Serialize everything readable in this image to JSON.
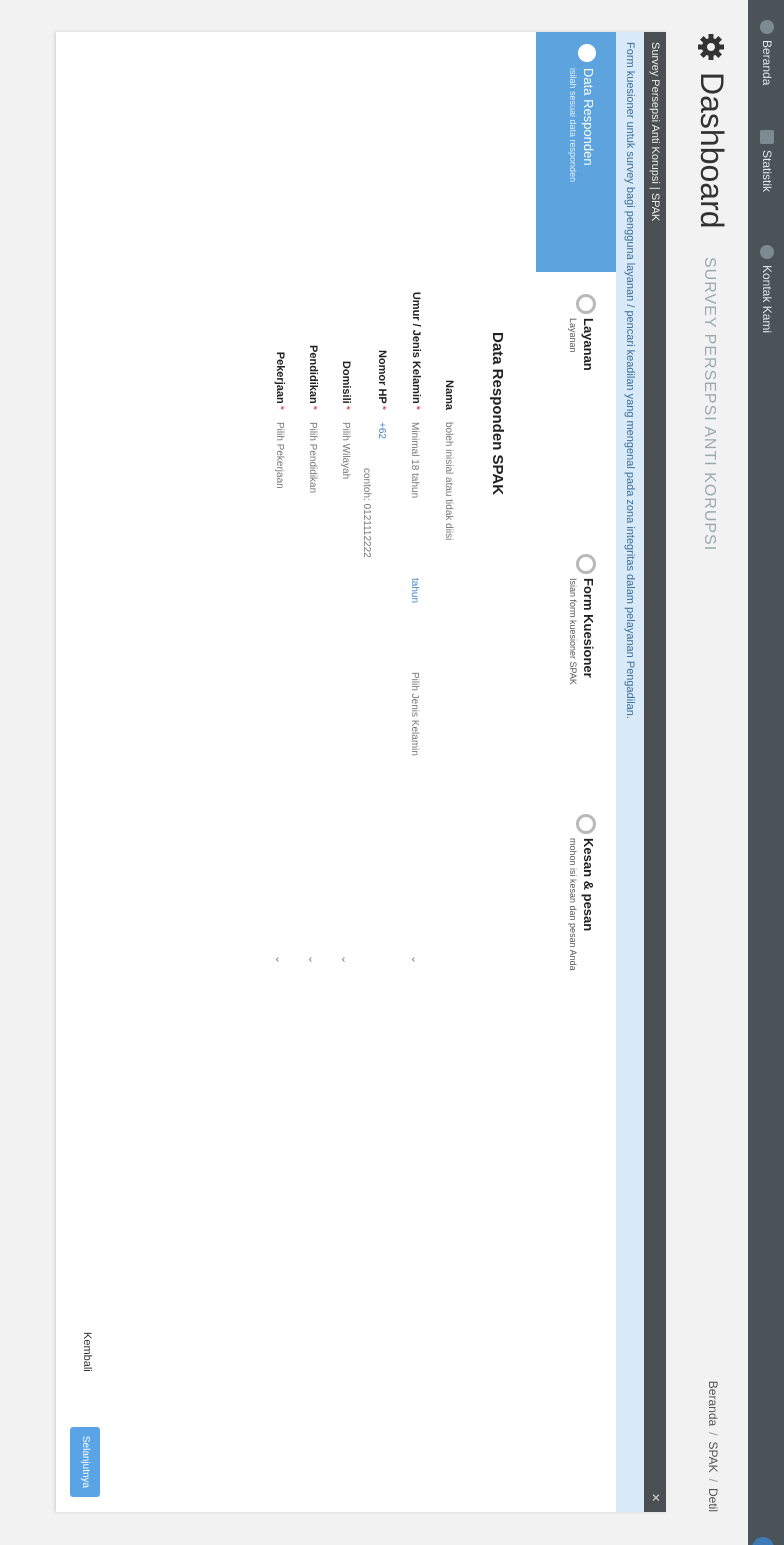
{
  "nav": {
    "items": [
      "Beranda",
      "Statistik",
      "Kontak Kami"
    ]
  },
  "header": {
    "title": "Dashboard",
    "subtitle": "SURVEY PERSEPSI ANTI KORUPSI",
    "breadcrumbs": [
      "Beranda",
      "SPAK",
      "Detil"
    ]
  },
  "card": {
    "title": "Survey Persepsi Anti Korupsi | SPAK",
    "close": "×",
    "info": "Form kuesioner untuk survey bagi pengguna layanan / pencari keadilan yang mengenal pada zona integritas dalam pelayanan Pengadilan."
  },
  "steps": [
    {
      "title": "Data Responden",
      "sub": "isilah sesuai data responden"
    },
    {
      "title": "Layanan",
      "sub": "Layanan"
    },
    {
      "title": "Form Kuesioner",
      "sub": "Isian form kuesioner SPAK"
    },
    {
      "title": "Kesan & pesan",
      "sub": "mohon isi kesan dan pesan Anda"
    }
  ],
  "form": {
    "title": "Data Responden SPAK",
    "nama": {
      "label": "Nama",
      "placeholder": "boleh inisial atau tidak diisi"
    },
    "umur": {
      "label": "Umur / Jenis Kelamin",
      "req": "*",
      "placeholder": "Minimal 18 tahun",
      "unit": "tahun",
      "gender_placeholder": "Pilih Jenis Kelamin"
    },
    "hp": {
      "label": "Nomor HP",
      "req": "*",
      "prefix": "+62",
      "placeholder": "contoh: 0121112222"
    },
    "domisili": {
      "label": "Domisili",
      "req": "*",
      "placeholder": "Pilih Wilayah"
    },
    "pendidikan": {
      "label": "Pendidikan",
      "req": "*",
      "placeholder": "Pilih Pendidikan"
    },
    "pekerjaan": {
      "label": "Pekerjaan",
      "req": "*",
      "placeholder": "Pilih Pekerjaan"
    }
  },
  "buttons": {
    "back": "Kembali",
    "next": "Selanjutnya"
  },
  "colors": {
    "nav": "#4a5458",
    "active_step": "#5da3dd",
    "info_bg": "#d8eaf7",
    "button": "#5aa4e6"
  }
}
